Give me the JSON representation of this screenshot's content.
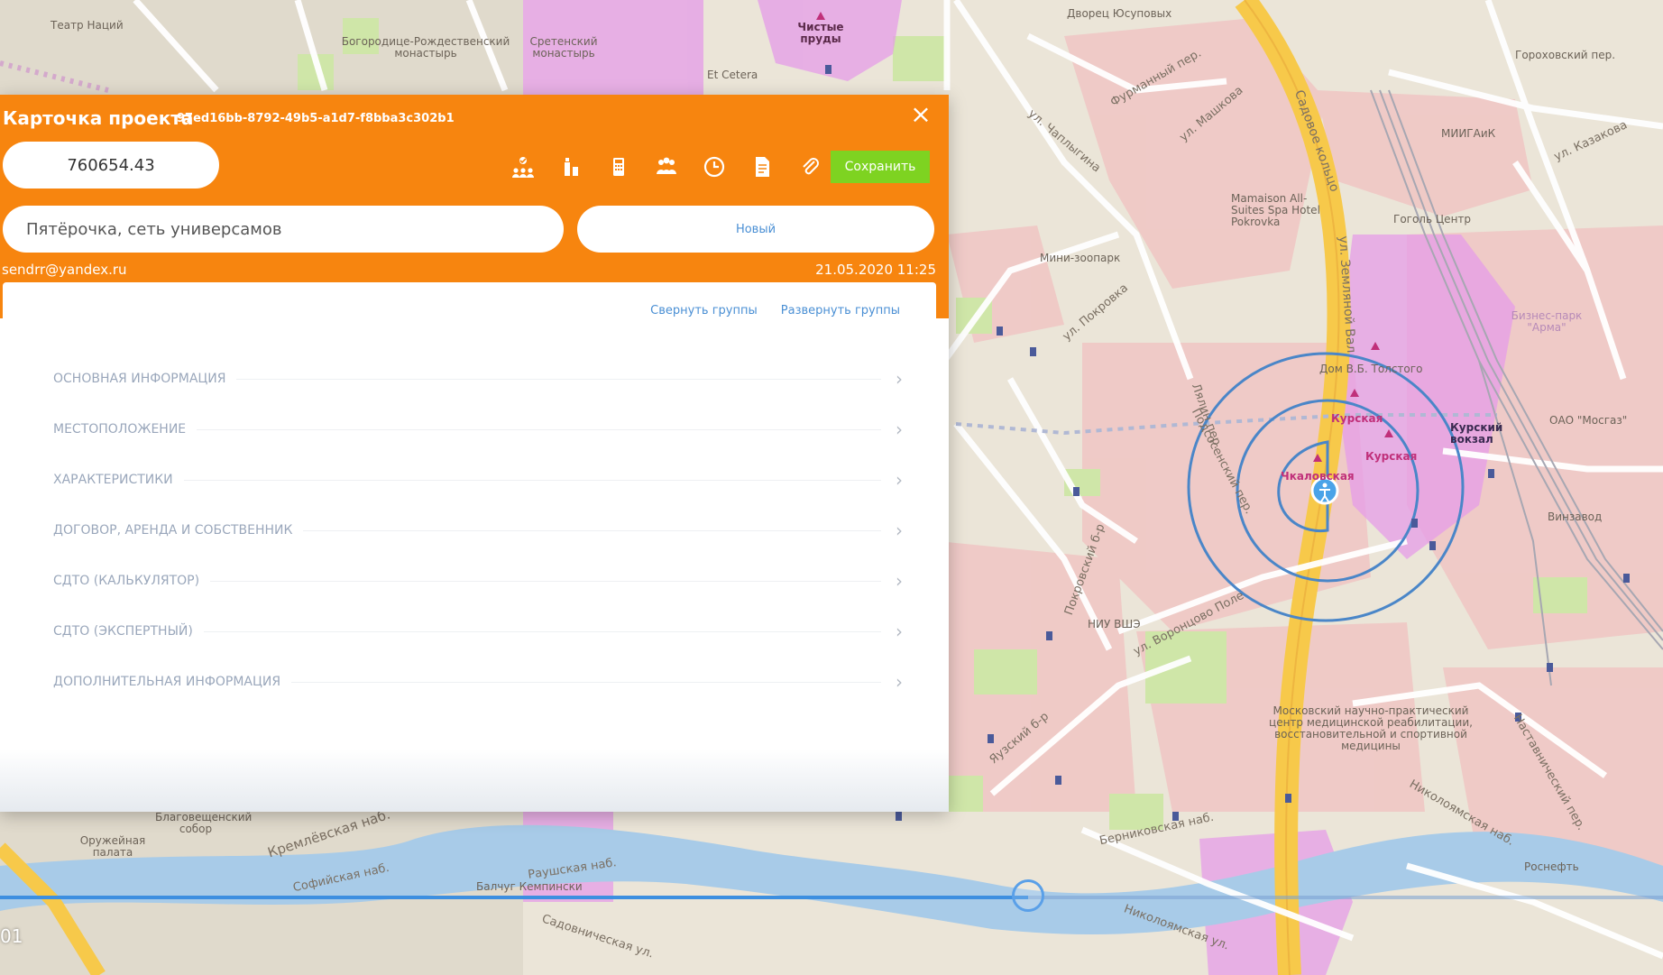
{
  "card": {
    "title": "Карточка проекта",
    "id": "97ed16bb-8792-49b5-a1d7-f8bba3c302b1",
    "close_icon": "×",
    "value": "760654.43",
    "name": "Пятёрочка, сеть универсамов",
    "status": "Новый",
    "email": "sendrr@yandex.ru",
    "date": "21.05.2020 11:25",
    "save_label": "Сохранить",
    "tools": [
      "people-check-icon",
      "bottle-icon",
      "calculator-icon",
      "group-icon",
      "clock-icon",
      "document-icon",
      "paperclip-icon"
    ],
    "collapse_label": "Свернуть группы",
    "expand_label": "Развернуть группы",
    "sections": [
      "ОСНОВНАЯ ИНФОРМАЦИЯ",
      "МЕСТОПОЛОЖЕНИЕ",
      "ХАРАКТЕРИСТИКИ",
      "ДОГОВОР, АРЕНДА И СОБСТВЕННИК",
      "СДТО (КАЛЬКУЛЯТОР)",
      "СДТО (ЭКСПЕРТНЫЙ)",
      "ДОПОЛНИТЕЛЬНАЯ ИНФОРМАЦИЯ"
    ],
    "accent_color": "#f7850f",
    "save_color": "#7ed321"
  },
  "map": {
    "labels": {
      "teatr": "Театр Наций",
      "bogorod": "Богородице-Рождественский монастырь",
      "sreten": "Сретенский монастырь",
      "chistye": "Чистые пруды",
      "etcetera": "Et Cetera",
      "dvorets": "Дворец Юсуповых",
      "furmanny": "Фурманный пер.",
      "mashkova": "ул. Машкова",
      "chaplygina": "ул. Чаплыгина",
      "sadovoe": "Садовое кольцо",
      "zemlyanoy": "ул. Земляной Вал",
      "mamaison": "Mamaison All-Suites Spa Hotel Pokrovka",
      "mini_zoo": "Мини-зоопарк",
      "pokrovka": "ул. Покровка",
      "gorohovsky": "Гороховский пер.",
      "kazakova": "ул. Казакова",
      "migaik": "МИИГАиК",
      "gogol": "Гоголь Центр",
      "arma": "Бизнес-парк \"Арма\"",
      "tolstoy": "Дом В.Б. Толстого",
      "kursk_station": "Курский вокзал",
      "mosgaz": "ОАО \"Мосгаз\"",
      "kurskaya1": "Курская",
      "kurskaya2": "Курская",
      "chkalovskaya": "Чкаловская",
      "podsosensky": "Подсосенский пер.",
      "lyalin": "Лялин пер.",
      "pokrovsky_bul": "Покровский б-р",
      "niu_vshe": "НИУ ВШЭ",
      "vorontsovo": "ул. Воронцово Поле",
      "yauzsky": "Яузский б-р",
      "vinzavod": "Винзавод",
      "rehab": "Московский научно-практический центр медицинской реабилитации, восстановительной и спортивной медицины",
      "nastavnichesky": "Наставнический пер.",
      "nikoloyamskaya_nab": "Николоямская наб.",
      "bernikovskaya": "Берниковская наб.",
      "nikoloyamskaya_ul": "Николоямская ул.",
      "kremlevskaya": "Кремлёвская наб.",
      "sofiyskaya": "Софийская наб.",
      "blagoveshchensky": "Благовещенский собор",
      "oruzheynaya": "Оружейная палата",
      "balchug": "Балчуг Кемпински",
      "raushskaya": "Раушская наб.",
      "sadovnicheskaya": "Садовническая ул.",
      "rosneft": "Роснефть"
    },
    "park_color": "#cfe6a8",
    "zone_color": "#e59ce8",
    "ring_color": "#4a86c8"
  },
  "player": {
    "progress": 0.618,
    "time": "01"
  }
}
